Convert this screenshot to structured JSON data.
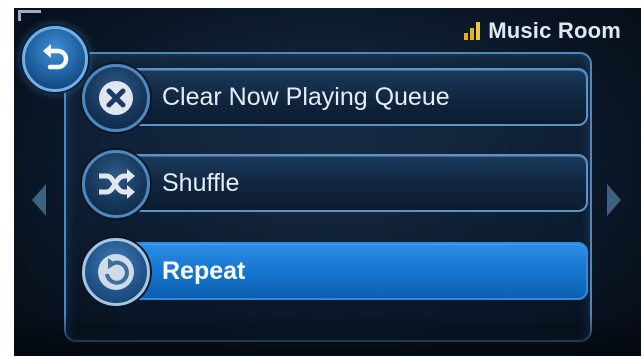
{
  "status_bar": {
    "room_name": "Music Room",
    "signal_icon": "signal-strength-icon"
  },
  "back_button": {
    "icon": "back-arrow-icon"
  },
  "menu": {
    "items": [
      {
        "label": "Clear Now Playing Queue",
        "icon": "clear-x-icon",
        "selected": false
      },
      {
        "label": "Shuffle",
        "icon": "shuffle-icon",
        "selected": false
      },
      {
        "label": "Repeat",
        "icon": "repeat-icon",
        "selected": true
      }
    ]
  },
  "nav": {
    "left_icon": "chevron-left-icon",
    "right_icon": "chevron-right-icon"
  },
  "colors": {
    "accent": "#1574cc",
    "panel_border": "#4f88bd",
    "signal": "#e8b020",
    "text": "#e4ecf4"
  }
}
